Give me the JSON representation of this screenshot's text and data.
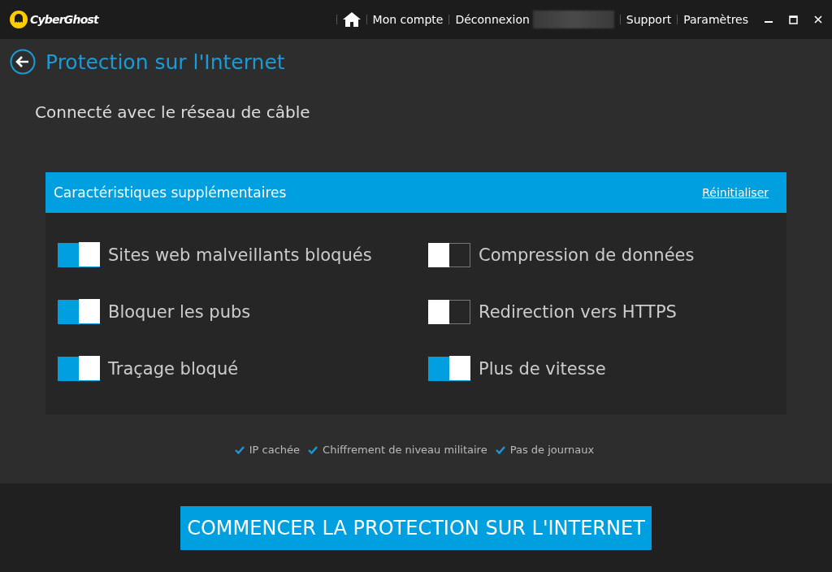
{
  "titlebar": {
    "brand": "CyberGhost",
    "nav": [
      "Mon compte",
      "Déconnexion",
      "Support",
      "Paramètres"
    ]
  },
  "page": {
    "title": "Protection sur l'Internet",
    "status": "Connecté avec le réseau de câble"
  },
  "features": {
    "title": "Caractéristiques supplémentaires",
    "reset": "Réinitialiser",
    "items": [
      {
        "label": "Sites web malveillants bloqués",
        "on": true
      },
      {
        "label": "Compression de données",
        "on": false
      },
      {
        "label": "Bloquer les pubs",
        "on": true
      },
      {
        "label": "Redirection vers HTTPS",
        "on": false
      },
      {
        "label": "Traçage bloqué",
        "on": true
      },
      {
        "label": "Plus de vitesse",
        "on": true
      }
    ]
  },
  "benefits": [
    "IP cachée",
    "Chiffrement de niveau militaire",
    "Pas de journaux"
  ],
  "start_button": "COMMENCER LA PROTECTION SUR L'INTERNET"
}
